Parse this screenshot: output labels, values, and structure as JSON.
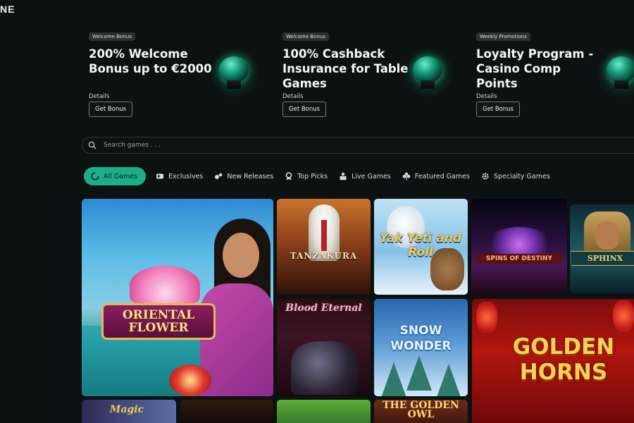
{
  "brand": {
    "logo_fragment": "NE"
  },
  "promos": [
    {
      "tag": "Welcome Bonus",
      "title": "200% Welcome Bonus up to €2000",
      "details": "Details",
      "button": "Get Bonus"
    },
    {
      "tag": "Welcome Bonus",
      "title": "100% Cashback Insurance for Table Games",
      "details": "Details",
      "button": "Get Bonus"
    },
    {
      "tag": "Weekly Promotions",
      "title": "Loyalty Program - Casino Comp Points",
      "details": "Details",
      "button": "Get Bonus"
    }
  ],
  "search": {
    "placeholder": "Search games . . ."
  },
  "tabs": [
    {
      "label": "All Games",
      "icon": "spinner-icon",
      "active": true
    },
    {
      "label": "Exclusives",
      "icon": "cards-icon"
    },
    {
      "label": "New Releases",
      "icon": "sparkle-icon"
    },
    {
      "label": "Top Picks",
      "icon": "trophy-icon"
    },
    {
      "label": "Live Games",
      "icon": "dealer-icon"
    },
    {
      "label": "Featured Games",
      "icon": "clover-icon"
    },
    {
      "label": "Specialty Games",
      "icon": "gear-icon"
    }
  ],
  "games": [
    {
      "title": "ORIENTAL FLOWER"
    },
    {
      "title": "TANZAKURA"
    },
    {
      "title": "Yak Yeti and Roll"
    },
    {
      "title": "SPINS OF DESTINY"
    },
    {
      "title": "SPHINX"
    },
    {
      "title": "Blood Eternal"
    },
    {
      "title": "SNOW WONDER"
    },
    {
      "title": "GOLDEN HORNS"
    },
    {
      "title": "Magic"
    },
    {
      "title": ""
    },
    {
      "title": ""
    },
    {
      "title": "THE GOLDEN OWL"
    }
  ],
  "colors": {
    "background": "#0b1211",
    "accent": "#1cae8a",
    "orb_glow": "#2fd8aa"
  }
}
